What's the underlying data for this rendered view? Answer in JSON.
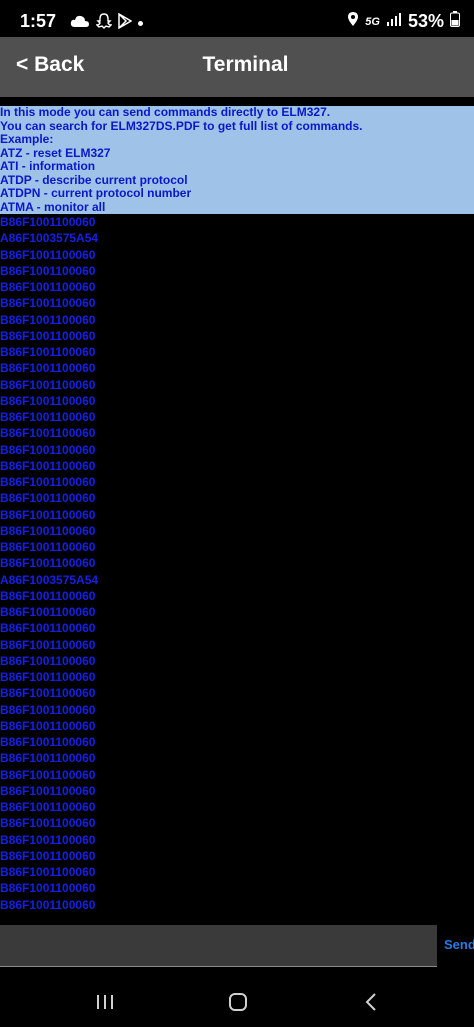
{
  "status_bar": {
    "time": "1:57",
    "network": "5G",
    "battery": "53%"
  },
  "header": {
    "back_label": "< Back",
    "title": "Terminal"
  },
  "terminal": {
    "intro": [
      "In this mode you can send commands directly to ELM327.",
      "You can search for ELM327DS.PDF to get full list of commands.",
      "Example:",
      "ATZ - reset ELM327",
      "ATI - information",
      "ATDP - describe current protocol",
      "ATDPN - current protocol number",
      "ATMA - monitor all"
    ],
    "log": [
      "B86F1001100060",
      "A86F1003575A54",
      "B86F1001100060",
      "B86F1001100060",
      "B86F1001100060",
      "B86F1001100060",
      "B86F1001100060",
      "B86F1001100060",
      "B86F1001100060",
      "B86F1001100060",
      "B86F1001100060",
      "B86F1001100060",
      "B86F1001100060",
      "B86F1001100060",
      "B86F1001100060",
      "B86F1001100060",
      "B86F1001100060",
      "B86F1001100060",
      "B86F1001100060",
      "B86F1001100060",
      "B86F1001100060",
      "B86F1001100060",
      "A86F1003575A54",
      "B86F1001100060",
      "B86F1001100060",
      "B86F1001100060",
      "B86F1001100060",
      "B86F1001100060",
      "B86F1001100060",
      "B86F1001100060",
      "B86F1001100060",
      "B86F1001100060",
      "B86F1001100060",
      "B86F1001100060",
      "B86F1001100060",
      "B86F1001100060",
      "B86F1001100060",
      "B86F1001100060",
      "B86F1001100060",
      "B86F1001100060",
      "B86F1001100060",
      "B86F1001100060",
      "B86F1001100060"
    ]
  },
  "input": {
    "value": "",
    "send_label": "Send"
  },
  "colors": {
    "header_bg": "#505050",
    "intro_bg": "#9ec2e8",
    "log_text": "#1420e6",
    "send": "#2a7be0"
  }
}
